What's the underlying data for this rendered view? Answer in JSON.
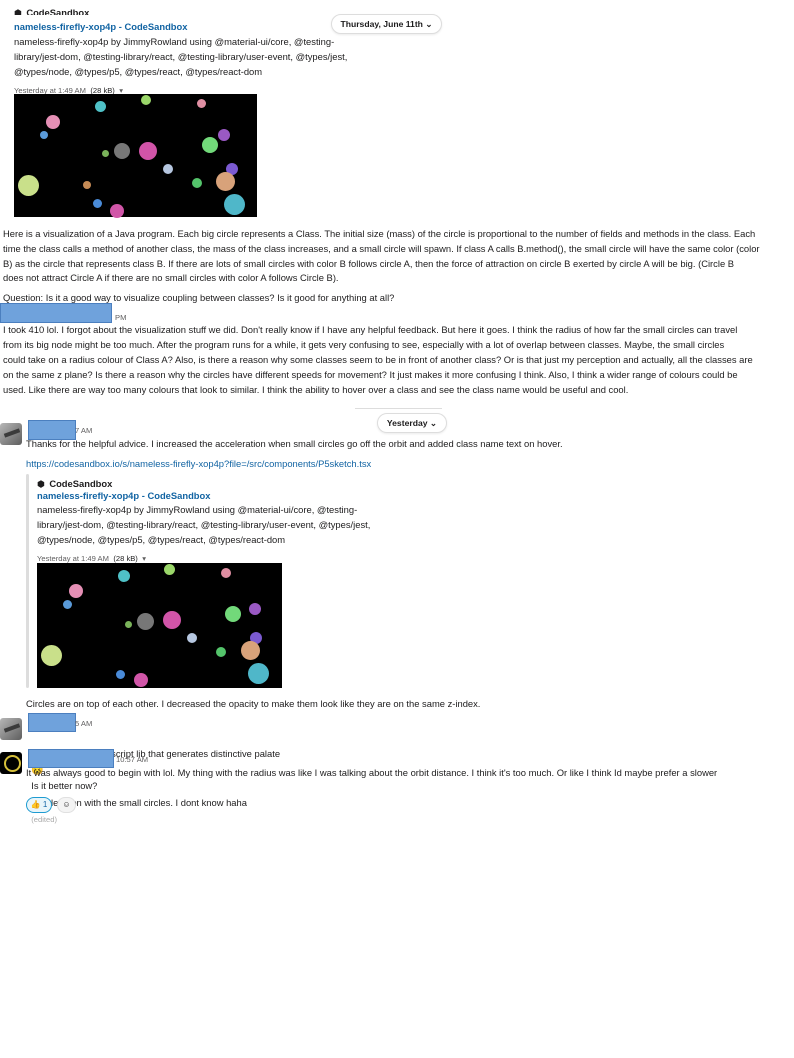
{
  "date_dividers": {
    "first": "Thursday, June 11th",
    "second": "Yesterday"
  },
  "chevron": "⌄",
  "unfurl": {
    "site": "CodeSandbox",
    "title": "nameless-firefly-xop4p - CodeSandbox",
    "description_lines": [
      "nameless-firefly-xop4p by JimmyRowland using @material-ui/core, @testing-",
      "library/jest-dom, @testing-library/react, @testing-library/user-event, @types/jest,",
      "@types/node, @types/p5, @types/react, @types/react-dom"
    ],
    "meta_time": "Yesterday at 1:49 AM",
    "meta_size": "(28 kB)",
    "meta_caret": "▾"
  },
  "unfurl2": {
    "description_lines": [
      "nameless-firefly-xop4p by JimmyRowland using @material-ui/core, @testing-",
      "library/jest-dom, @testing-library/react, @testing-library/user-event, @types/jest,",
      "@types/node, @types/p5, @types/react, @types/react-dom"
    ]
  },
  "messages": {
    "visualization_lines": [
      "Here is a visualization of a Java program. Each big circle represents a Class. The initial size (mass) of the circle is proportional to the number of fields and methods in the class. Each",
      "time the class calls a method of another class, the mass of the class increases, and a small circle will spawn. If class A calls B.method(), the small circle will have the same color (color",
      "B) as the circle that represents class B. If there are lots of small circles with color B follows circle A, then the force of attraction on circle B exerted by circle A will be big. (Circle B",
      "does not attract Circle A if there are no small circles with color A follows Circle B)."
    ],
    "question": "Question: Is it a good way to visualize coupling between classes? Is it good for anything at all?",
    "reply1_time": "PM",
    "reply1_lines": [
      "I took 410 lol. I forgot about the visualization stuff we did. Don't really know if I have any helpful feedback. But here it goes. I think the radius of how far the small circles can travel",
      "from its big node might be too much. After the program runs for a while, it gets very confusing to see, especially with a lot of overlap between classes. Maybe, the small circles",
      "could take on a radius colour of Class A? Also, is there a reason why some classes seem to be in front of another class? Or is that just my perception and actually, all the classes are",
      "on the same z plane? Is there a reason why the circles have different speeds for movement? It just makes it more confusing I think. Also, I think a wider range of colours could be",
      "used. Like there are way too many colours that look to similar. I think the ability to hover over a class and see the class name would be useful and cool."
    ],
    "reply2_time": "7 AM",
    "reply2_text": "Thanks for the helpful advice. I increased the acceleration when small circles go off the orbit and added class name text on hover.",
    "reply2_link": "https://codesandbox.io/s/nameless-firefly-xop4p?file=/src/components/P5sketch.tsx",
    "opacity_text": "Circles are on top of each other. I decreased the opacity to make them look like they are on the same z-index.",
    "reply3_time": "5 AM",
    "reply3_text": "Couldn't find a typescript lib that generates distinctive palate",
    "reply3_after": "Is it better now?",
    "reply4_time": "10:57 AM",
    "reply4_lines": [
      "It was always good to begin with lol. My thing with the radius was like I was talking about the orbit distance. I think it's too much. Or like I think Id maybe prefer a slower",
      "acceleration with the small circles. I dont know haha"
    ],
    "edited": "(edited)",
    "reaction_emoji": "👍",
    "reaction_count": "1",
    "add_reaction_icon": "☺",
    "emoji_confused": "😣"
  },
  "colors": {
    "link": "#1264a3",
    "redaction": "#6fa2dc",
    "reaction_bg": "#e8f5fa",
    "reaction_border": "#1d9bd1"
  }
}
